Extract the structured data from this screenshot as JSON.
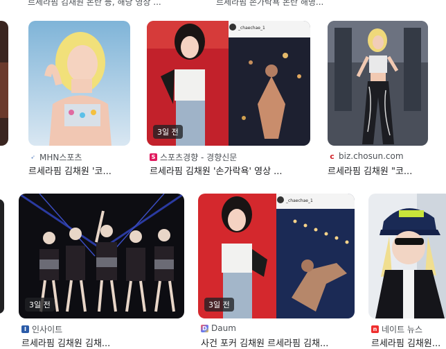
{
  "top_strip": {
    "left_text": "르세라핌 김채원 논란 등, 해당 영상 ...",
    "right_text": "르세라핌 손가락욕 논란 해명..."
  },
  "row1": [
    {
      "source": "MHN스포츠",
      "title": "르세라핌 김채원 '코...",
      "badge": "",
      "favicon": "feather-icon",
      "favicon_color": "#6a8fc7"
    },
    {
      "source": "스포츠경향 - 경향신문",
      "title": "르세라핌 김채원 '손가락욕' 영상 ...",
      "badge": "3일 전",
      "favicon": "sportskh-icon",
      "favicon_color": "#e0195d"
    },
    {
      "source": "biz.chosun.com",
      "title": "르세라핌 김채원 \"코...",
      "badge": "",
      "favicon": "chosun-c-icon",
      "favicon_color": "#d2232a"
    }
  ],
  "row2": [
    {
      "source": "인사이트",
      "title": "르세라핌 김채원 김채...",
      "badge": "3일 전",
      "favicon": "insight-icon",
      "favicon_color": "#2b5ba8"
    },
    {
      "source": "Daum",
      "title": "사건 포커 김채원 르세라핌 김채...",
      "badge": "3일 전",
      "favicon": "daum-icon",
      "favicon_color": "#7b6cf6"
    },
    {
      "source": "네이트 뉴스",
      "title": "르세라핌 김채원...",
      "badge": "",
      "favicon": "nate-icon",
      "favicon_color": "#ef2f2f"
    }
  ],
  "overlay_texts": {
    "insta_handle_1": "_chaechae_1",
    "insta_handle_2": "_chaechae_1"
  }
}
